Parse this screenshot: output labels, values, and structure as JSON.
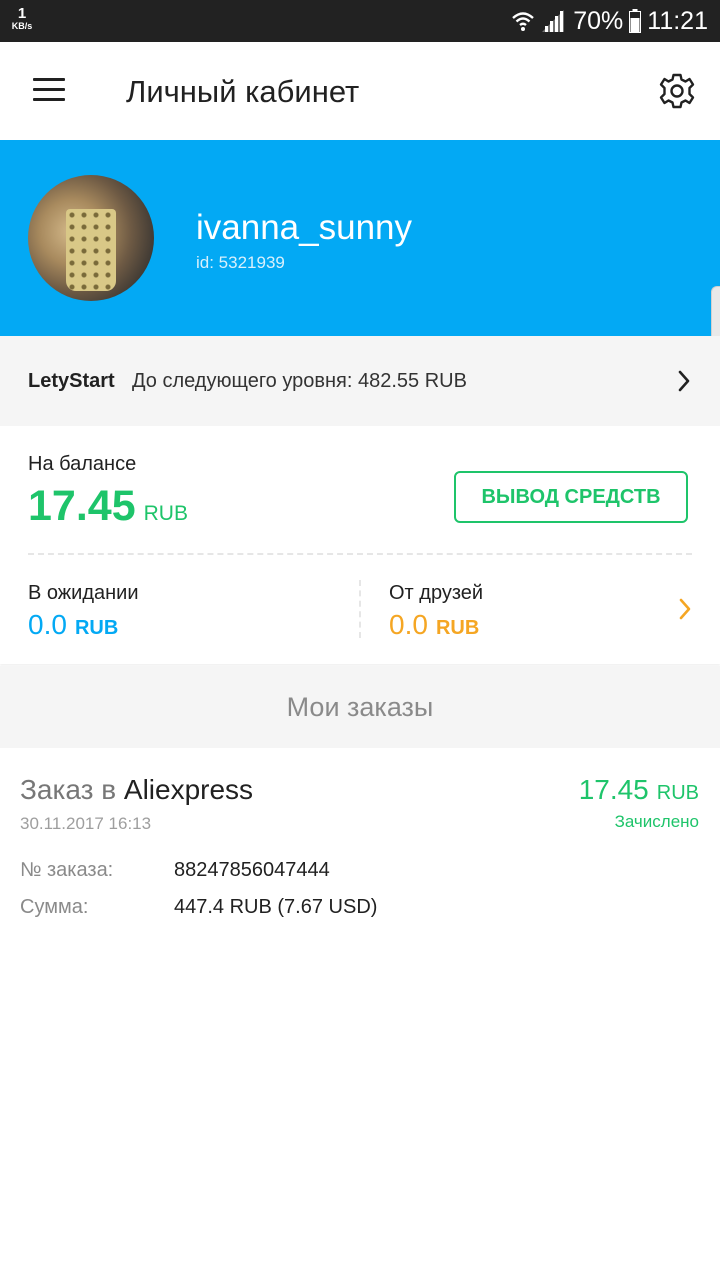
{
  "status_bar": {
    "net_speed": "1",
    "net_unit": "KB/s",
    "battery_percent": "70%",
    "time": "11:21"
  },
  "app_bar": {
    "title": "Личный кабинет",
    "menu_icon": "menu-icon",
    "settings_icon": "gear-icon"
  },
  "profile": {
    "username": "ivanna_sunny",
    "user_id": "id: 5321939"
  },
  "level": {
    "name": "LetyStart",
    "text": "До следующего уровня: 482.55 RUB"
  },
  "balance": {
    "label": "На балансе",
    "amount": "17.45",
    "currency": "RUB",
    "withdraw_label": "ВЫВОД СРЕДСТВ",
    "pending_label": "В ожидании",
    "pending_amount": "0.0",
    "pending_currency": "RUB",
    "friends_label": "От друзей",
    "friends_amount": "0.0",
    "friends_currency": "RUB"
  },
  "orders": {
    "header": "Мои заказы",
    "items": [
      {
        "title_prefix": "Заказ в",
        "shop": "Aliexpress",
        "date": "30.11.2017  16:13",
        "amount": "17.45",
        "currency": "RUB",
        "status": "Зачислено",
        "order_no_label": "№ заказа:",
        "order_no": "88247856047444",
        "sum_label": "Сумма:",
        "sum": "447.4 RUB (7.67 USD)"
      }
    ]
  },
  "colors": {
    "accent_blue": "#03a9f4",
    "green": "#1ec46a",
    "orange": "#f5a623",
    "status_bar": "#222222"
  }
}
